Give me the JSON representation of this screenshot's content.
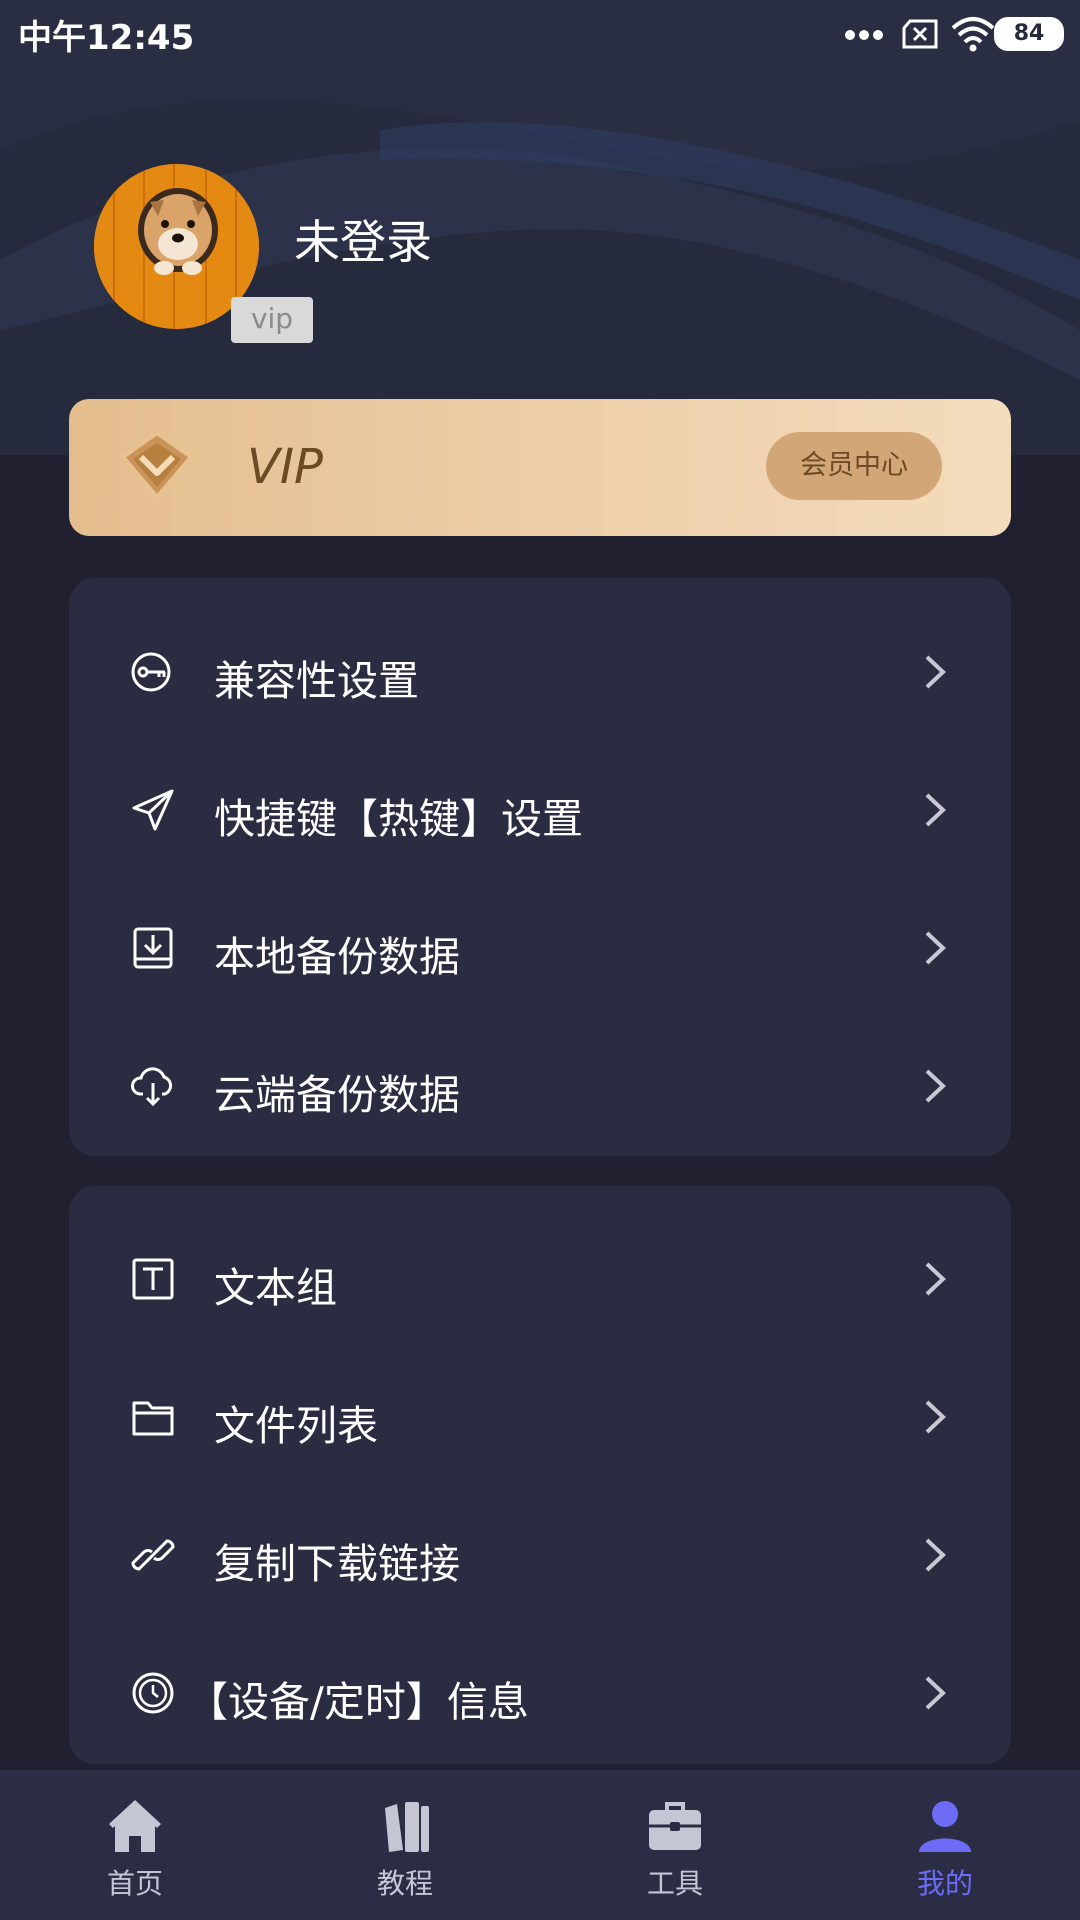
{
  "status_bar": {
    "time": "中午12:45",
    "battery": "84",
    "icons": [
      "more-dots-icon",
      "sim-off-icon",
      "wifi-icon",
      "battery-icon"
    ]
  },
  "profile": {
    "name": "未登录",
    "vip_tag": "vip",
    "avatar": "shiba-dog-photo"
  },
  "vip_banner": {
    "label": "VIP",
    "button": "会员中心",
    "colors": {
      "gradient_start": "#e4bd8e",
      "gradient_end": "#f3dcbc",
      "text": "#6b4a24"
    }
  },
  "settings_menu": [
    {
      "icon": "key-icon",
      "label": "兼容性设置"
    },
    {
      "icon": "paper-plane-icon",
      "label": "快捷键【热键】设置"
    },
    {
      "icon": "download-box-icon",
      "label": "本地备份数据"
    },
    {
      "icon": "cloud-download-icon",
      "label": "云端备份数据"
    }
  ],
  "tools_menu": [
    {
      "icon": "text-box-icon",
      "label": "文本组"
    },
    {
      "icon": "folder-icon",
      "label": "文件列表"
    },
    {
      "icon": "link-icon",
      "label": "复制下载链接"
    },
    {
      "icon": "clock-icon",
      "label": "【设备/定时】信息"
    }
  ],
  "tab_bar": {
    "tabs": [
      {
        "icon": "home-icon",
        "label": "首页",
        "active": false
      },
      {
        "icon": "books-icon",
        "label": "教程",
        "active": false
      },
      {
        "icon": "toolbox-icon",
        "label": "工具",
        "active": false
      },
      {
        "icon": "user-icon",
        "label": "我的",
        "active": true
      }
    ],
    "active_color": "#6c6cf6"
  }
}
